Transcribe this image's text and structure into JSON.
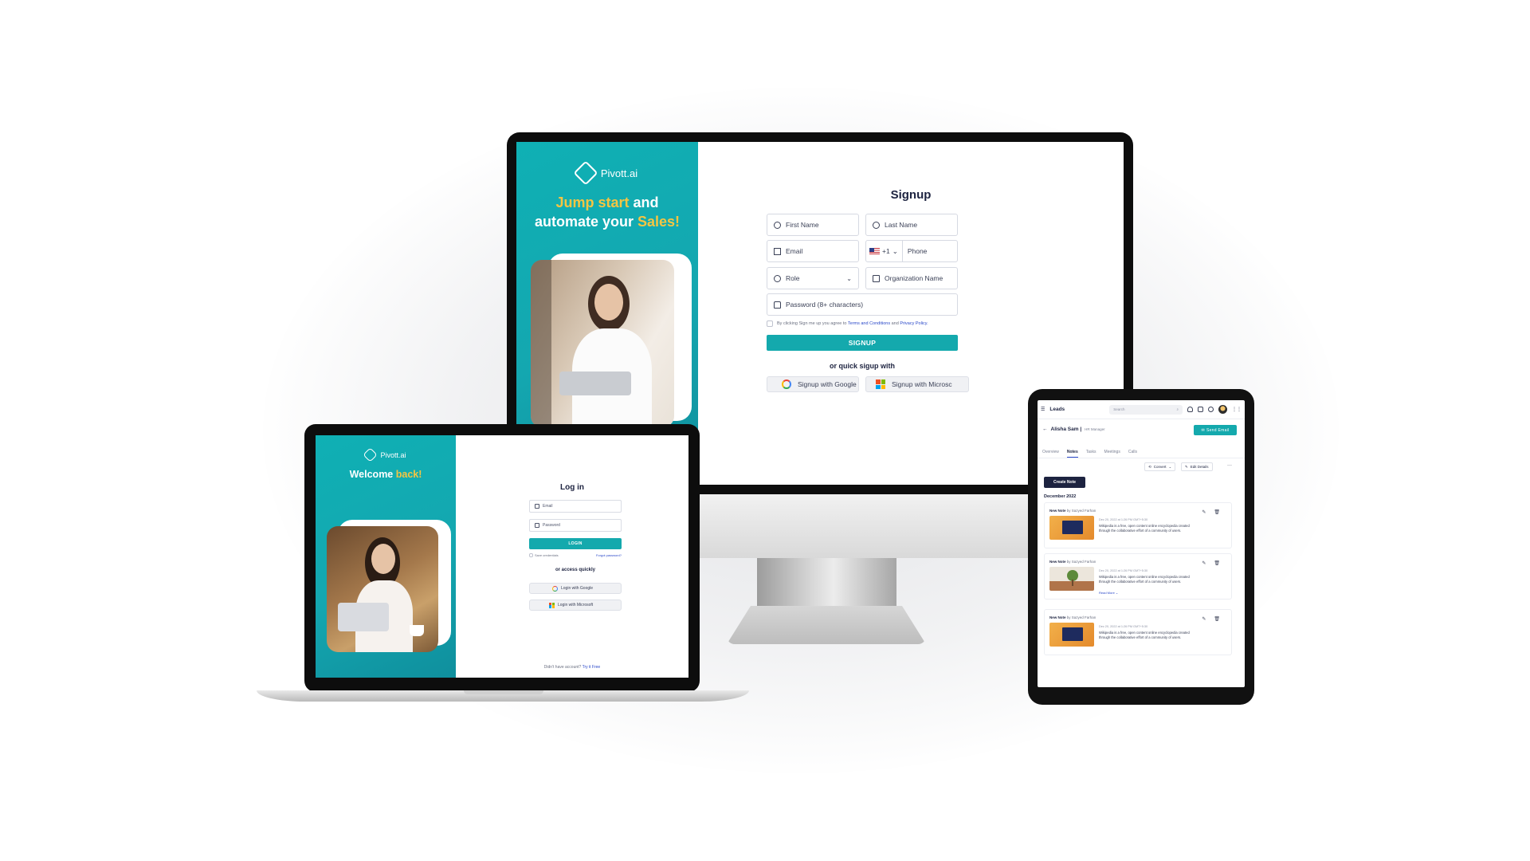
{
  "desktop": {
    "brand": "Pivott.ai",
    "hero": {
      "part1": "Jump start",
      "part2": " and",
      "part3": "automate your ",
      "part4": "Sales!"
    },
    "form": {
      "title": "Signup",
      "first_name": "First Name",
      "last_name": "Last Name",
      "email": "Email",
      "country_code": "+1",
      "phone": "Phone",
      "role": "Role",
      "organization": "Organization Name",
      "password": "Password (8+ characters)",
      "terms_prefix": "By clicking Sign me up you agree to ",
      "terms_link": "Terms and Conditions",
      "terms_and": " and ",
      "privacy_link": "Privacy Policy.",
      "signup_button": "SIGNUP",
      "quick_signup": "or quick sigup with",
      "google_button": "Signup with Google",
      "microsoft_button": "Signup with Microsc"
    }
  },
  "laptop": {
    "brand": "Pivott.ai",
    "hero": {
      "part1": "Welcome ",
      "part2": "back!"
    },
    "form": {
      "title": "Log in",
      "email": "Email",
      "password": "Password",
      "login_button": "LOGIN",
      "save_credentials": "Save credentials",
      "forgot_password": "Forgot password?",
      "quick_access": "or access quickly",
      "google_button": "Login with Google",
      "microsoft_button": "Login with Microsoft",
      "no_account": "Didn't have account? ",
      "try_free": "Try it Free"
    }
  },
  "tablet": {
    "page_title": "Leads",
    "search_placeholder": "Search",
    "lead_name": "Alisha Sam |",
    "lead_role": "HR Manager",
    "send_email": "Send Email",
    "tabs": [
      "Overview",
      "Notes",
      "Tasks",
      "Meetings",
      "Calls"
    ],
    "active_tab": "Notes",
    "convert": "Convert",
    "edit_details": "Edit Details",
    "create_note": "Create Note",
    "month": "December 2022",
    "notes": [
      {
        "title": "New Note",
        "by": " by Sazyed Farhan",
        "date": "Dec 20, 2022 at 1:26 PM GMT+5:30",
        "text": "Wikipedia is a free, open content online encyclopedia created through the collaborative effort of a community of users.",
        "more": ""
      },
      {
        "title": "New Note",
        "by": " by Sazyed Farhan",
        "date": "Dec 20, 2022 at 1:26 PM GMT+5:30",
        "text": "Wikipedia is a free, open content online encyclopedia created through the collaborative effort of a community of users.",
        "more": "Read More ⌄"
      },
      {
        "title": "New Note",
        "by": " by Sazyed Farhan",
        "date": "Dec 20, 2022 at 1:26 PM GMT+5:30",
        "text": "Wikipedia is a free, open content online encyclopedia created through the collaborative effort of a community of users.",
        "more": ""
      }
    ]
  },
  "colors": {
    "teal": "#14a9ad",
    "yellow": "#f5c542",
    "navy": "#1d2340",
    "link": "#2a48c9"
  }
}
